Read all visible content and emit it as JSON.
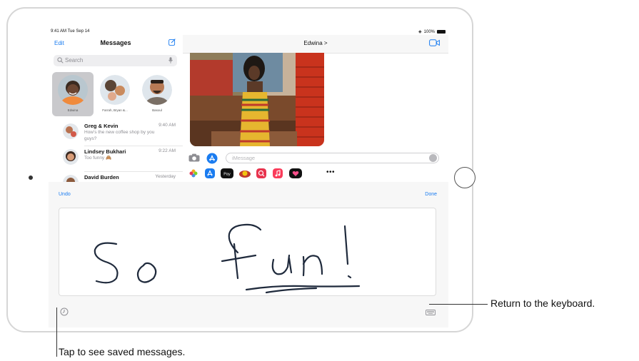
{
  "status_bar": {
    "time_date": "9:41 AM  Tue Sep 14",
    "battery": "100%"
  },
  "sidebar": {
    "edit_label": "Edit",
    "title": "Messages",
    "search_placeholder": "Search",
    "pinned": [
      {
        "name": "Edwina",
        "selected": true
      },
      {
        "name": "Farrah, Bryan &...",
        "selected": false
      },
      {
        "name": "Basoul",
        "selected": false
      }
    ],
    "conversations": [
      {
        "name": "Greg & Kevin",
        "time": "9:40 AM",
        "preview": "How's the new coffee shop by you guys?"
      },
      {
        "name": "Lindsey Bukhari",
        "time": "9:22 AM",
        "preview": "Too funny 🙈"
      },
      {
        "name": "David Burden",
        "time": "Yesterday",
        "preview": ""
      }
    ]
  },
  "chat": {
    "contact_name": "Edwina >",
    "input_placeholder": "iMessage",
    "apps": [
      "photos-app",
      "app-store-app",
      "apple-pay-app",
      "stickers-app",
      "search-images-app",
      "music-app",
      "memoji-app",
      "more-apps"
    ]
  },
  "handwriting": {
    "undo_label": "Undo",
    "done_label": "Done",
    "written_text": "So fun!"
  },
  "callouts": {
    "keyboard": "Return to the keyboard.",
    "saved": "Tap to see saved messages."
  },
  "colors": {
    "accent": "#1a7cf0",
    "ink": "#1f2a3c"
  }
}
